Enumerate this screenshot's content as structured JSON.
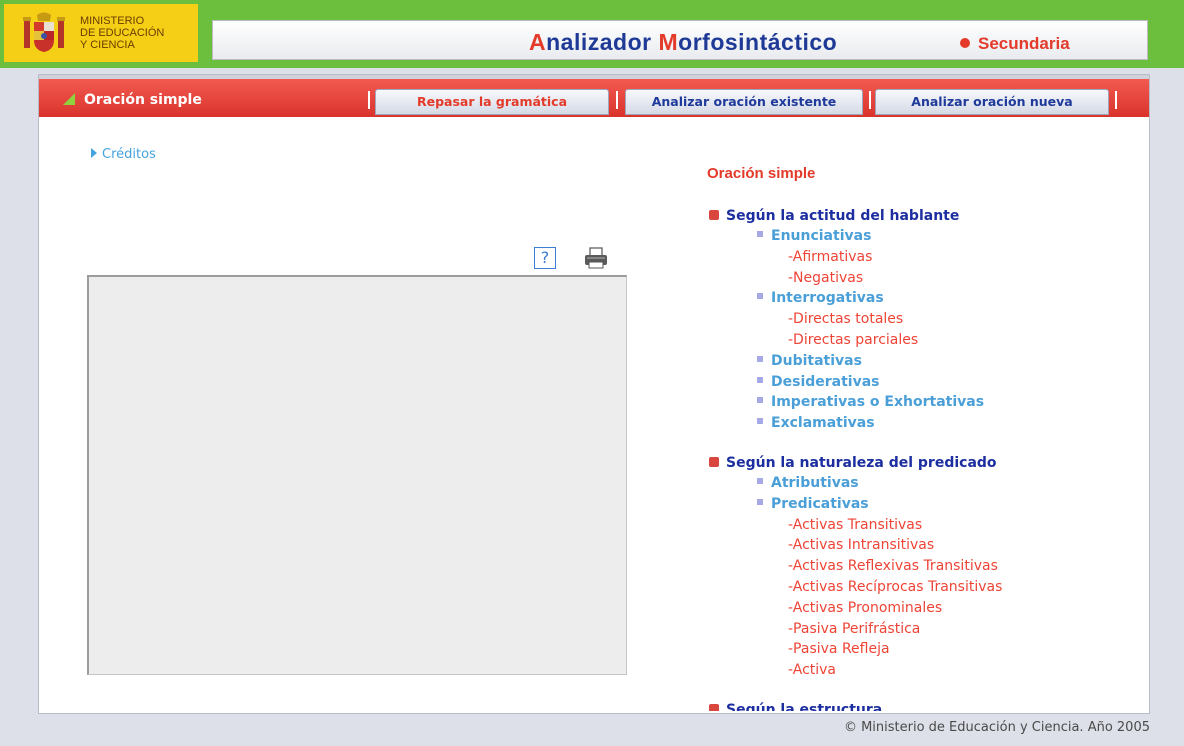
{
  "header": {
    "ministry_lines": [
      "MINISTERIO",
      "DE EDUCACIÓN",
      "Y CIENCIA"
    ],
    "app_title_parts": [
      {
        "cap": "A",
        "rest": "nalizador "
      },
      {
        "cap": "M",
        "rest": "orfosintáctico"
      }
    ],
    "level": "Secundaria"
  },
  "navbar": {
    "current_section": "Oración simple",
    "buttons": [
      {
        "label": "Repasar la gramática"
      },
      {
        "label": "Analizar oración existente"
      },
      {
        "label": "Analizar oración nueva"
      }
    ]
  },
  "left": {
    "credits_link": "Créditos"
  },
  "tree": {
    "title": "Oración simple",
    "sections": [
      {
        "label": "Según la actitud del hablante",
        "items": [
          {
            "label": "Enunciativas",
            "children": [
              "-Afirmativas",
              "-Negativas"
            ]
          },
          {
            "label": "Interrogativas",
            "children": [
              "-Directas totales",
              "-Directas parciales"
            ]
          },
          {
            "label": "Dubitativas",
            "children": []
          },
          {
            "label": "Desiderativas",
            "children": []
          },
          {
            "label": "Imperativas o Exhortativas",
            "children": []
          },
          {
            "label": "Exclamativas",
            "children": []
          }
        ]
      },
      {
        "label": "Según la naturaleza del predicado",
        "items": [
          {
            "label": "Atributivas",
            "children": []
          },
          {
            "label": "Predicativas",
            "children": [
              "-Activas Transitivas",
              "-Activas Intransitivas",
              "-Activas Reflexivas Transitivas",
              "-Activas Recíprocas Transitivas",
              "-Activas Pronominales",
              "-Pasiva Perifrástica",
              "-Pasiva Refleja",
              "-Activa"
            ]
          }
        ]
      },
      {
        "label": "Según la estructura",
        "items": []
      }
    ]
  },
  "footer": {
    "copyright": "© Ministerio de Educación y Ciencia. Año 2005"
  },
  "colors": {
    "header_green": "#6bbf3c",
    "ministry_yellow": "#f4cf16",
    "nav_red": "#e0372e",
    "title_blue": "#1e3a96",
    "accent_red": "#e33a2a",
    "link_blue": "#4a9fd8"
  },
  "icons": {
    "help": "?"
  }
}
